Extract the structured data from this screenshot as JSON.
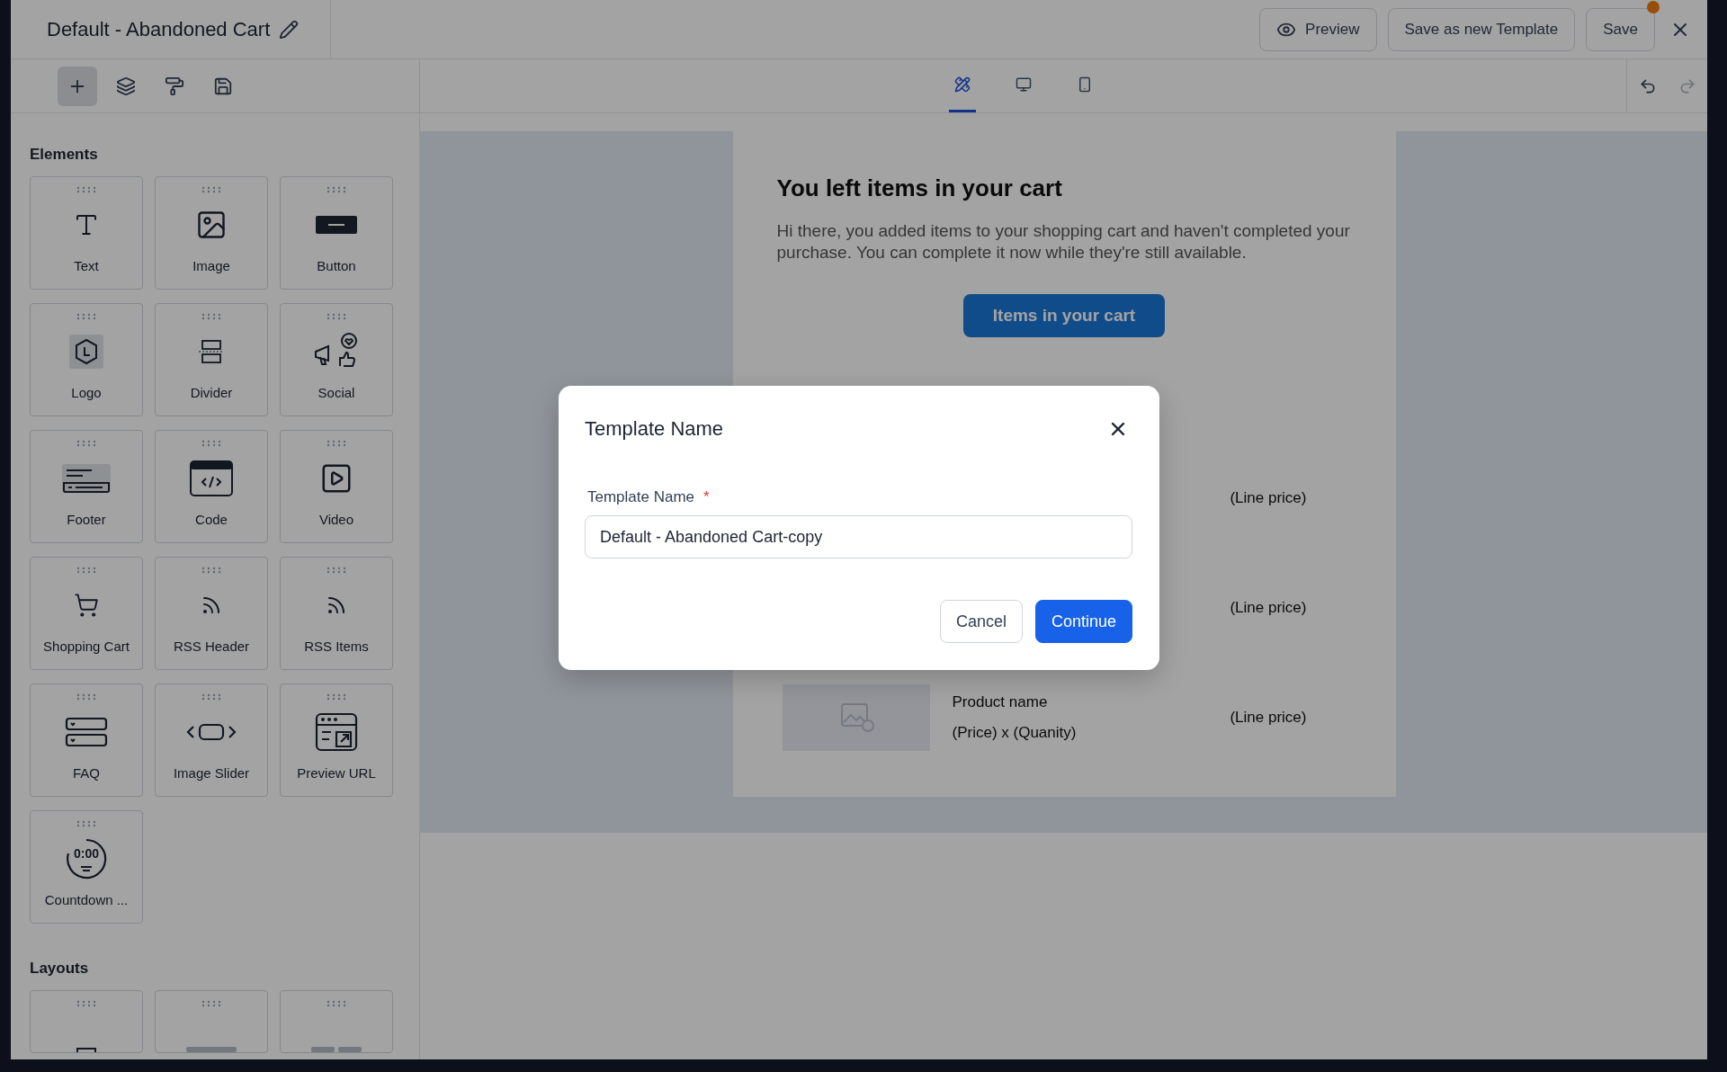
{
  "header": {
    "title": "Default - Abandoned Cart",
    "buttons": [
      {
        "label": "Preview",
        "kind": "preview"
      },
      {
        "label": "Save as new Template",
        "kind": "plain"
      },
      {
        "label": "Save",
        "kind": "save",
        "notification": true
      }
    ]
  },
  "left_toolbar": [
    {
      "kind": "add",
      "selected": true
    },
    {
      "kind": "layers",
      "selected": false
    },
    {
      "kind": "style",
      "selected": false
    },
    {
      "kind": "save",
      "selected": false
    }
  ],
  "view_tabs": [
    {
      "kind": "tools",
      "selected": true
    },
    {
      "kind": "desktop",
      "selected": false
    },
    {
      "kind": "mobile",
      "selected": false
    }
  ],
  "history": [
    {
      "kind": "undo",
      "disabled": false
    },
    {
      "kind": "redo",
      "disabled": true
    }
  ],
  "elements": {
    "title": "Elements",
    "items": [
      {
        "label": "Text",
        "kind": "text"
      },
      {
        "label": "Image",
        "kind": "image"
      },
      {
        "label": "Button",
        "kind": "button"
      },
      {
        "label": "Logo",
        "kind": "logo"
      },
      {
        "label": "Divider",
        "kind": "divider"
      },
      {
        "label": "Social",
        "kind": "social"
      },
      {
        "label": "Footer",
        "kind": "footer"
      },
      {
        "label": "Code",
        "kind": "code"
      },
      {
        "label": "Video",
        "kind": "video"
      },
      {
        "label": "Shopping Cart",
        "kind": "cart"
      },
      {
        "label": "RSS Header",
        "kind": "rss"
      },
      {
        "label": "RSS Items",
        "kind": "rss"
      },
      {
        "label": "FAQ",
        "kind": "faq"
      },
      {
        "label": "Image Slider",
        "kind": "slider"
      },
      {
        "label": "Preview URL",
        "kind": "preview_url"
      },
      {
        "label": "Countdown ...",
        "kind": "countdown",
        "icon_text": "0:00"
      }
    ]
  },
  "layouts": {
    "title": "Layouts",
    "items": [
      {
        "kind": "one"
      },
      {
        "kind": "bar"
      },
      {
        "kind": "two"
      }
    ]
  },
  "email": {
    "heading": "You left items in your cart",
    "body": "Hi there, you added items to your shopping cart and haven't completed your purchase. You can complete it now while they're still available.",
    "button": "Items in your cart",
    "items": [
      {
        "kind": "price_only",
        "line_price": "(Line price)"
      },
      {
        "kind": "price_only",
        "line_price": "(Line price)"
      },
      {
        "kind": "full",
        "name": "Product name",
        "price": "(Price) x (Quanity)",
        "line_price": "(Line price)"
      }
    ]
  },
  "dialog": {
    "title": "Template Name",
    "field": {
      "label": "Template Name",
      "required_mark": "*",
      "value": "Default - Abandoned Cart-copy"
    },
    "buttons": [
      {
        "label": "Cancel",
        "kind": "secondary"
      },
      {
        "label": "Continue",
        "kind": "primary"
      }
    ]
  }
}
